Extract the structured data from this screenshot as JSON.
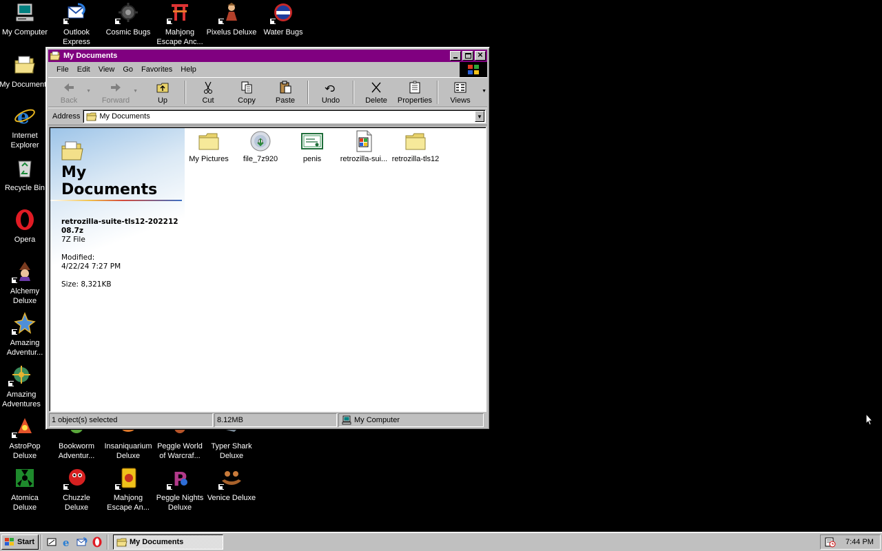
{
  "desktop": {
    "icons": [
      {
        "label": "My Computer",
        "icon": "my-computer-icon"
      },
      {
        "label": "Outlook Express",
        "icon": "outlook-express-icon"
      },
      {
        "label": "Cosmic Bugs",
        "icon": "cosmic-bugs-icon"
      },
      {
        "label": "Mahjong Escape Anc...",
        "icon": "mahjong-escape-icon"
      },
      {
        "label": "Pixelus Deluxe",
        "icon": "pixelus-deluxe-icon"
      },
      {
        "label": "Water Bugs",
        "icon": "water-bugs-icon"
      },
      {
        "label": "My Documents",
        "icon": "my-documents-icon"
      },
      {
        "label": "Internet Explorer",
        "icon": "internet-explorer-icon"
      },
      {
        "label": "Recycle Bin",
        "icon": "recycle-bin-icon"
      },
      {
        "label": "Opera",
        "icon": "opera-icon"
      },
      {
        "label": "Alchemy Deluxe",
        "icon": "alchemy-deluxe-icon"
      },
      {
        "label": "Amazing Adventur...",
        "icon": "amazing-adventures-icon"
      },
      {
        "label": "Amazing Adventures",
        "icon": "amazing-adventures-2-icon"
      },
      {
        "label": "AstroPop Deluxe",
        "icon": "astropop-deluxe-icon"
      },
      {
        "label": "Bookworm Adventur...",
        "icon": "bookworm-icon"
      },
      {
        "label": "Insaniquarium Deluxe",
        "icon": "insaniquarium-icon"
      },
      {
        "label": "Peggle World of Warcraf...",
        "icon": "peggle-wow-icon"
      },
      {
        "label": "Typer Shark Deluxe",
        "icon": "typer-shark-icon"
      },
      {
        "label": "Atomica Deluxe",
        "icon": "atomica-icon"
      },
      {
        "label": "Chuzzle Deluxe",
        "icon": "chuzzle-icon"
      },
      {
        "label": "Mahjong Escape An...",
        "icon": "mahjong-escape-2-icon"
      },
      {
        "label": "Peggle Nights Deluxe",
        "icon": "peggle-nights-icon"
      },
      {
        "label": "Venice Deluxe",
        "icon": "venice-deluxe-icon"
      }
    ]
  },
  "window": {
    "title": "My Documents",
    "menu": [
      "File",
      "Edit",
      "View",
      "Go",
      "Favorites",
      "Help"
    ],
    "toolbar": {
      "back": "Back",
      "forward": "Forward",
      "up": "Up",
      "cut": "Cut",
      "copy": "Copy",
      "paste": "Paste",
      "undo": "Undo",
      "delete": "Delete",
      "properties": "Properties",
      "views": "Views"
    },
    "address": {
      "label": "Address",
      "value": "My Documents"
    },
    "webview": {
      "title_line1": "My",
      "title_line2": "Documents",
      "selected_name": "retrozilla-suite-tls12-20221208.7z",
      "selected_type": "7Z File",
      "modified_label": "Modified:",
      "modified_value": "4/22/24 7:27 PM",
      "size": "Size: 8,321KB"
    },
    "files": [
      {
        "name": "My Pictures",
        "icon": "folder-icon"
      },
      {
        "name": "file_7z920",
        "icon": "installer-disc-icon"
      },
      {
        "name": "penis",
        "icon": "certificate-icon"
      },
      {
        "name": "retrozilla-sui...",
        "icon": "archive-file-icon"
      },
      {
        "name": "retrozilla-tls12",
        "icon": "folder-icon"
      }
    ],
    "status": {
      "selection": "1 object(s) selected",
      "size": "8.12MB",
      "zone": "My Computer"
    }
  },
  "taskbar": {
    "start": "Start",
    "task": "My Documents",
    "clock": "7:44 PM"
  },
  "colors": {
    "desktop": "#000000",
    "titlebar": "#800080",
    "face": "#c0c0c0"
  }
}
